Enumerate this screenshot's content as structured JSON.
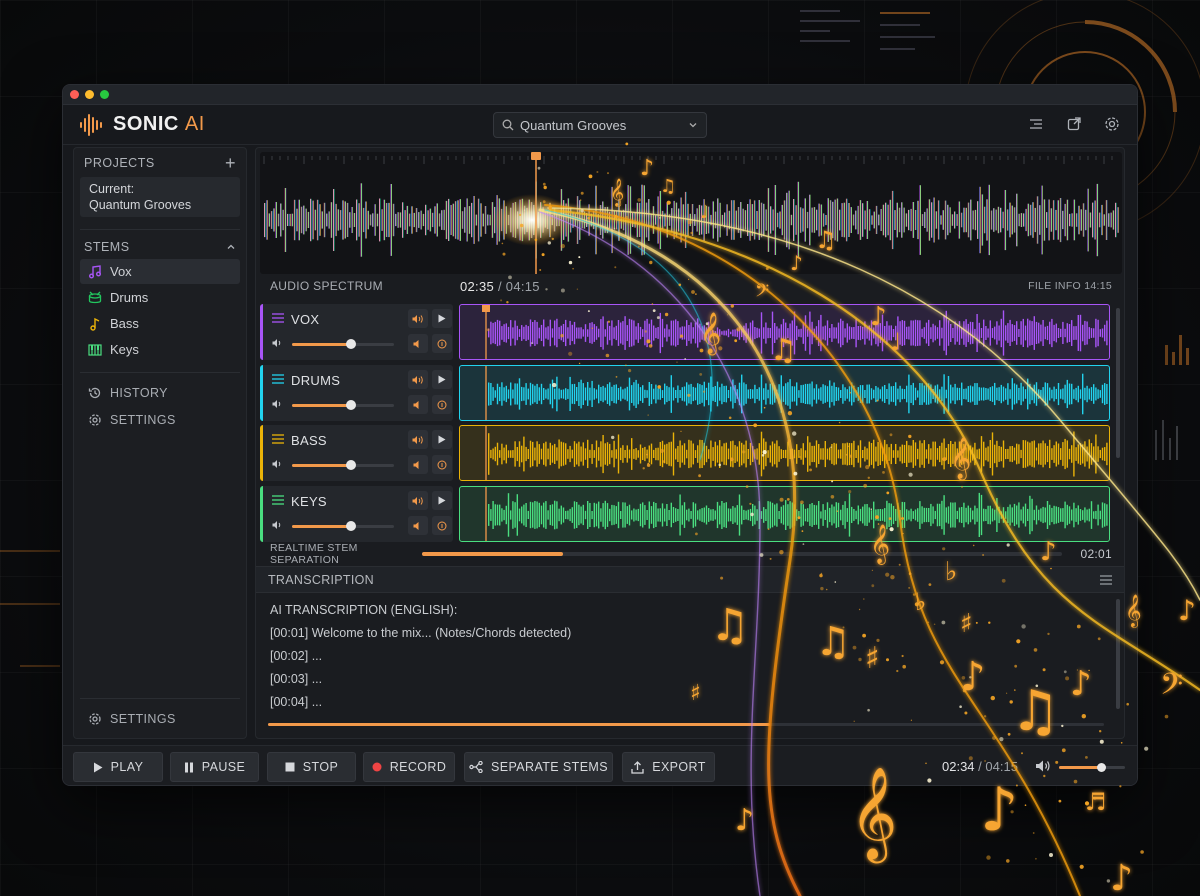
{
  "app": {
    "logo_main": "SONIC",
    "logo_accent": "AI",
    "search_value": "Quantum Grooves"
  },
  "sidebar": {
    "projects_label": "PROJECTS",
    "current_label": "Current:",
    "current_value": "Quantum Grooves",
    "stems_label": "STEMS",
    "stems": [
      {
        "label": "Vox",
        "icon": "music-note-icon",
        "color": "#a855f7"
      },
      {
        "label": "Drums",
        "icon": "drums-icon",
        "color": "#22c55e"
      },
      {
        "label": "Bass",
        "icon": "music-note-icon",
        "color": "#eab308"
      },
      {
        "label": "Keys",
        "icon": "piano-icon",
        "color": "#4ade80"
      }
    ],
    "history_label": "HISTORY",
    "settings_label": "SETTINGS",
    "bottom_settings_label": "SETTINGS"
  },
  "spectrum": {
    "label": "AUDIO SPECTRUM",
    "current_time": "02:35",
    "total_time": "/ 04:15",
    "file_info": "FILE INFO 14:15"
  },
  "tracks": [
    {
      "name": "VOX",
      "color": "#a855f7",
      "volume": 0.58
    },
    {
      "name": "DRUMS",
      "color": "#22d3ee",
      "volume": 0.58
    },
    {
      "name": "BASS",
      "color": "#eab308",
      "volume": 0.58
    },
    {
      "name": "KEYS",
      "color": "#4ade80",
      "volume": 0.58
    }
  ],
  "separation": {
    "label": "REALTIME STEM SEPARATION",
    "progress": 0.22,
    "time": "02:01"
  },
  "transcription": {
    "label": "TRANSCRIPTION",
    "lines": [
      "AI TRANSCRIPTION (ENGLISH):",
      "[00:01] Welcome to the mix... (Notes/Chords detected)",
      "[00:02] ...",
      "[00:03] ...",
      "[00:04] ..."
    ],
    "progress": 0.6
  },
  "transport": {
    "play": "PLAY",
    "pause": "PAUSE",
    "stop": "STOP",
    "record": "RECORD",
    "separate": "SEPARATE STEMS",
    "export": "EXPORT",
    "current_time": "02:34",
    "total_time": "/ 04:15",
    "volume": 0.64
  },
  "colors": {
    "accent": "#f2994a",
    "record": "#ef4444"
  }
}
